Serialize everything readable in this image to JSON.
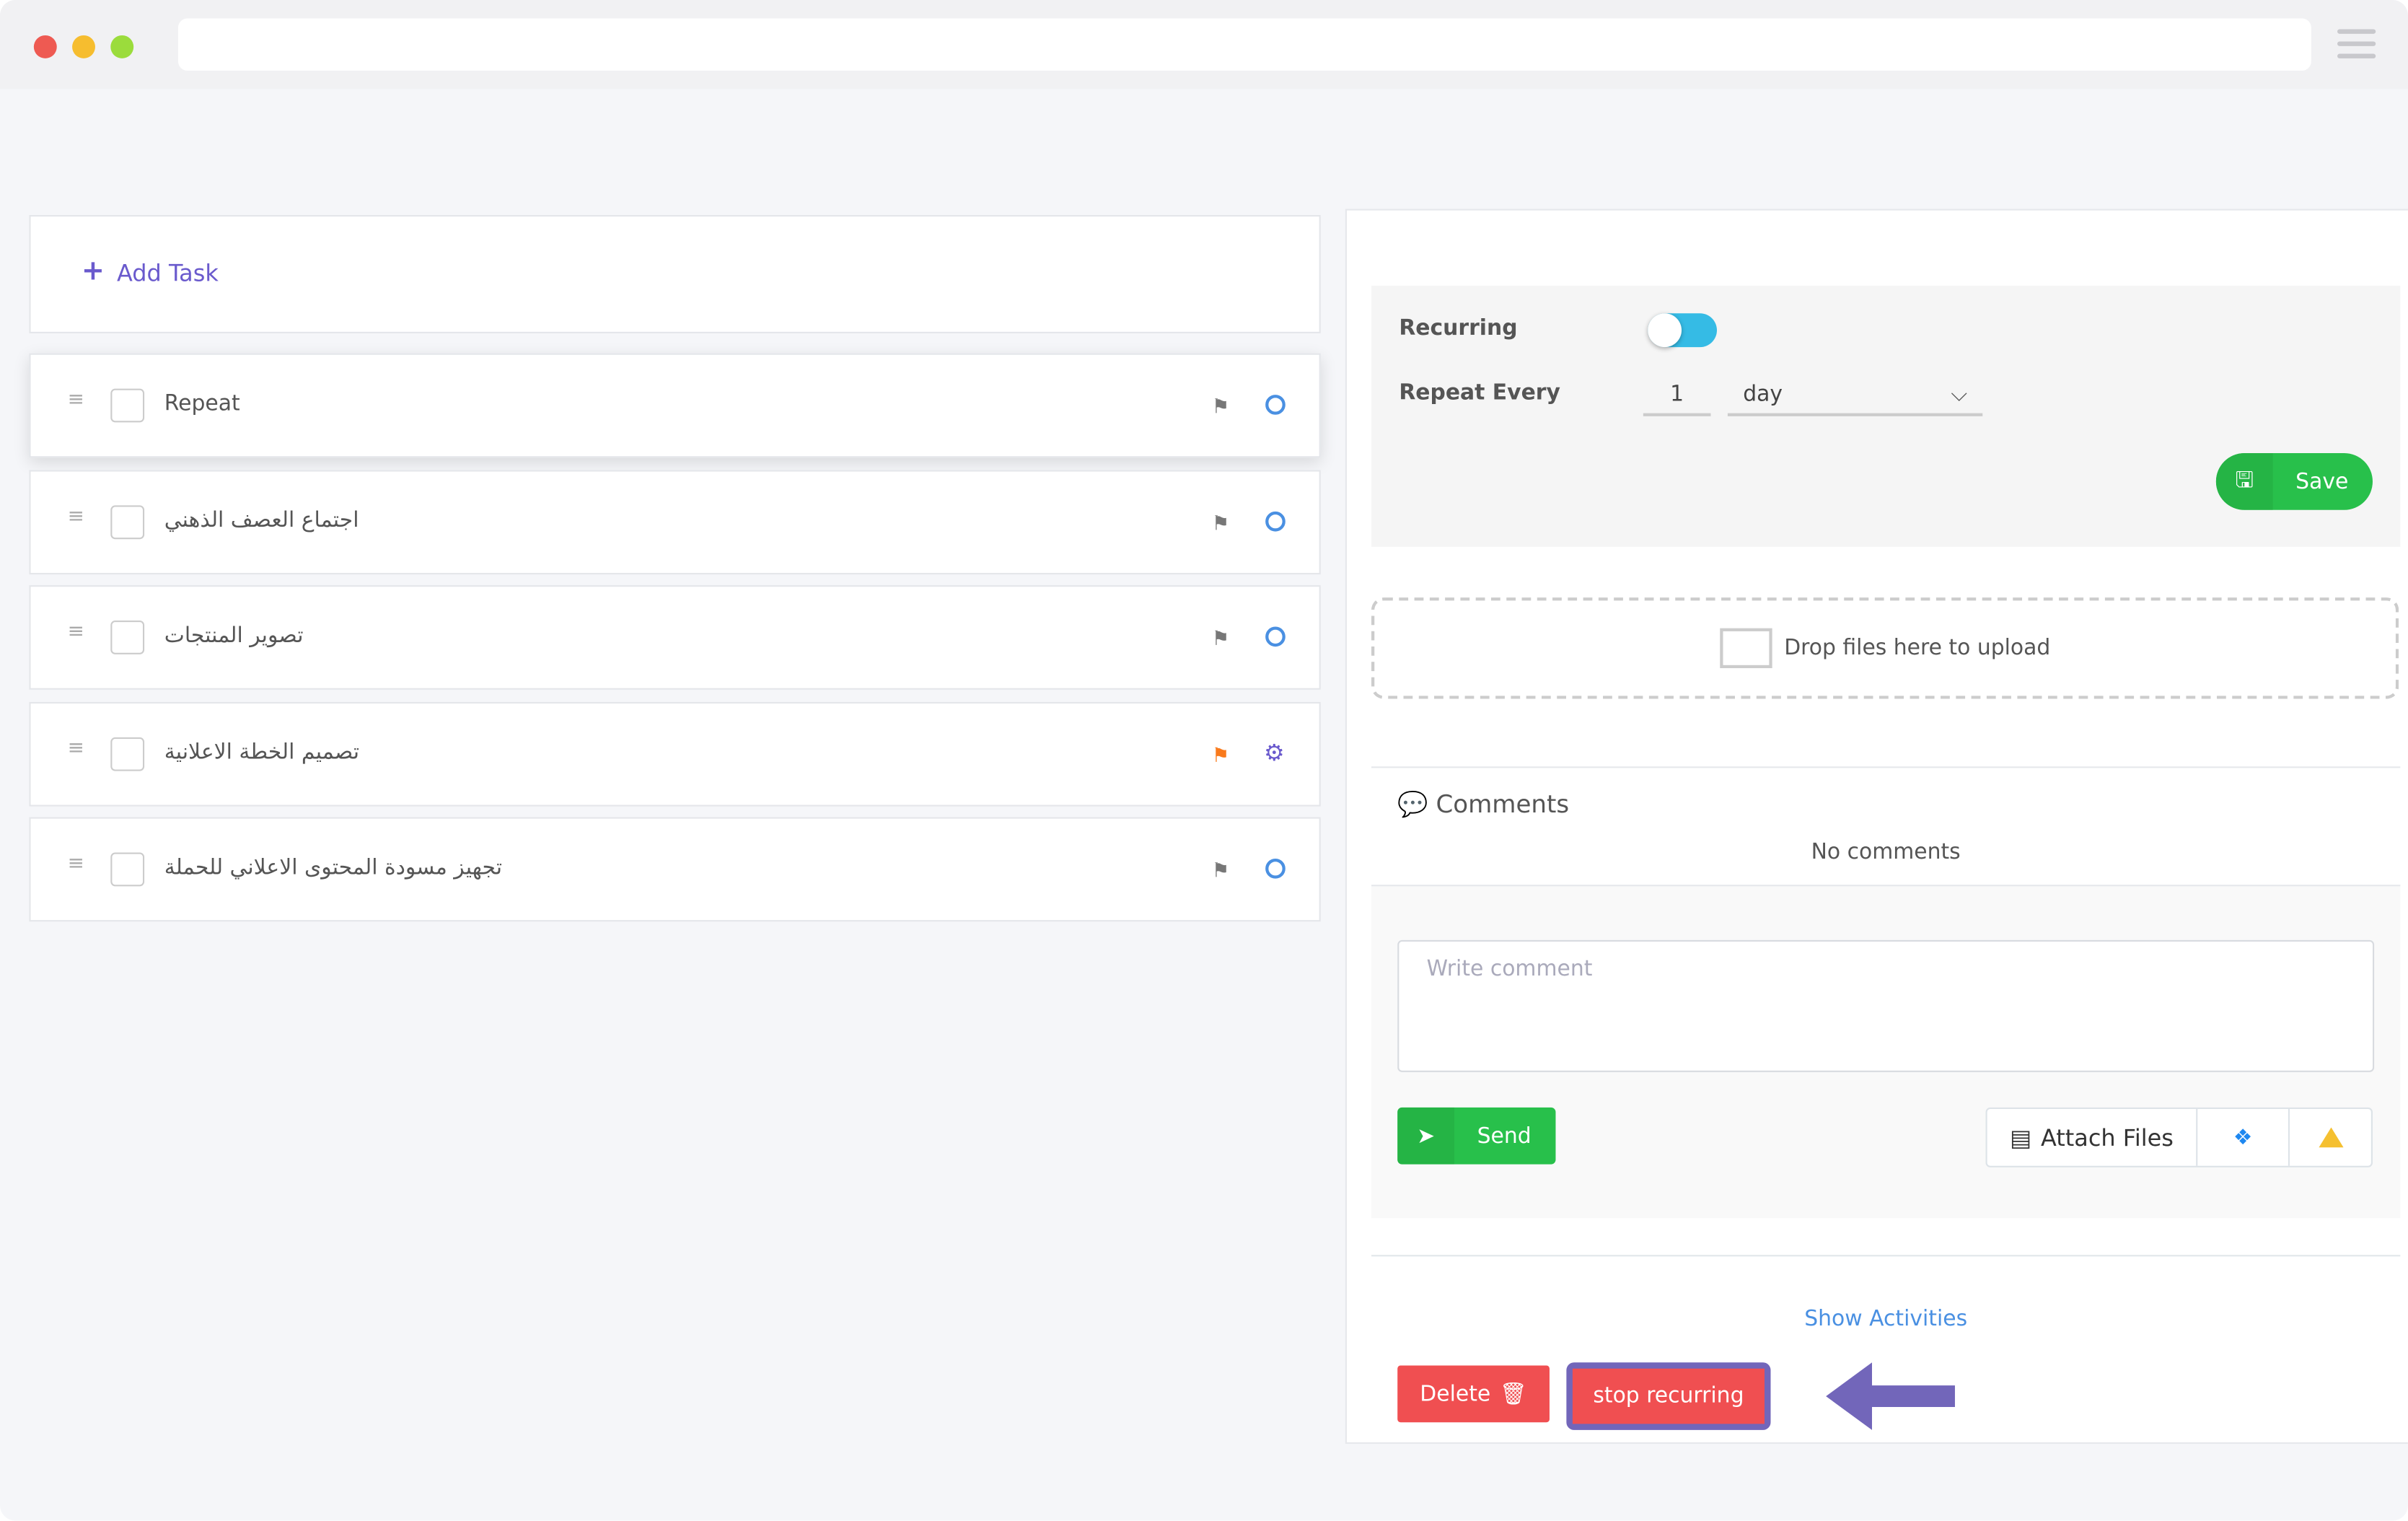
{
  "browser": {
    "traffic_lights": [
      "#ee5a52",
      "#f6bd2f",
      "#61c454"
    ]
  },
  "add_task": {
    "label": "Add Task",
    "icon": "plus-icon"
  },
  "tasks": [
    {
      "name": "Repeat",
      "flag_color": "#777777",
      "status_icon": "clock-icon"
    },
    {
      "name": "اجتماع العصف الذهني",
      "flag_color": "#777777",
      "status_icon": "clock-icon"
    },
    {
      "name": "تصوير المنتجات",
      "flag_color": "#777777",
      "status_icon": "clock-icon"
    },
    {
      "name": "تصميم الخطة الاعلانية",
      "flag_color": "#f97a1c",
      "status_icon": "gears-icon"
    },
    {
      "name": "تجهيز مسودة المحتوى الاعلاني للحملة",
      "flag_color": "#777777",
      "status_icon": "clock-icon"
    }
  ],
  "recurring": {
    "label": "Recurring",
    "enabled": true,
    "repeat_label": "Repeat Every",
    "interval": "1",
    "unit": "day",
    "save_label": "Save"
  },
  "upload": {
    "label": "Drop files here to upload"
  },
  "comments": {
    "title": "Comments",
    "empty": "No comments",
    "placeholder": "Write comment",
    "send_label": "Send",
    "attach_label": "Attach Files"
  },
  "footer": {
    "show_activities": "Show Activities",
    "delete_label": "Delete",
    "stop_label": "stop recurring"
  },
  "colors": {
    "green": "#28c04b",
    "red": "#f04f51",
    "purple": "#7266ba",
    "blue": "#4a90e2"
  }
}
